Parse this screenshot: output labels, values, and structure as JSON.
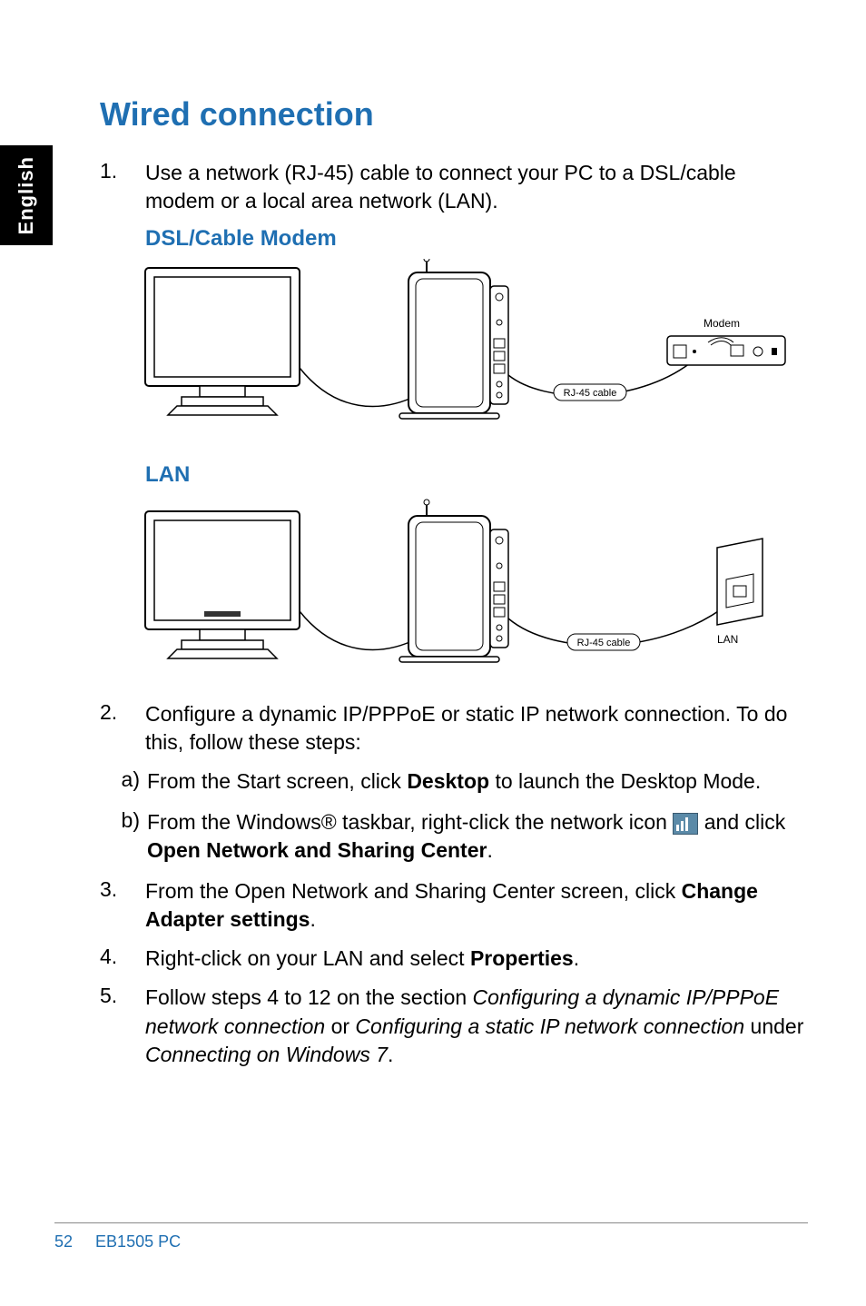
{
  "side_tab": "English",
  "heading": "Wired connection",
  "step1_num": "1.",
  "step1_body": "Use a network (RJ-45) cable to connect your PC to a DSL/cable modem or a local area network (LAN).",
  "dsl_heading": "DSL/Cable Modem",
  "dsl_modem_label": "Modem",
  "dsl_cable_label": "RJ-45 cable",
  "lan_heading": "LAN",
  "lan_cable_label": "RJ-45 cable",
  "lan_label": "LAN",
  "step2_num": "2.",
  "step2_body": "Configure a dynamic IP/PPPoE or static IP network connection. To do this, follow these steps:",
  "step2a_num": "a)",
  "step2a_pre": "From the Start screen, click ",
  "step2a_bold": "Desktop",
  "step2a_post": " to launch the Desktop Mode.",
  "step2b_num": "b)",
  "step2b_pre": "From the Windows® taskbar, right-click the network icon ",
  "step2b_post1": " and click ",
  "step2b_bold": "Open Network and Sharing Center",
  "step2b_post2": ".",
  "step3_num": "3.",
  "step3_pre": "From the Open Network and Sharing Center screen, click ",
  "step3_bold": "Change Adapter settings",
  "step3_post": ".",
  "step4_num": "4.",
  "step4_pre": "Right-click on your LAN and select ",
  "step4_bold": "Properties",
  "step4_post": ".",
  "step5_num": "5.",
  "step5_pre": "Follow steps 4 to 12 on the section ",
  "step5_it1": "Configuring a dynamic IP/PPPoE network connection",
  "step5_mid1": " or ",
  "step5_it2": "Configuring a static IP network connection",
  "step5_mid2": " under ",
  "step5_it3": "Connecting on Windows 7",
  "step5_post": ".",
  "footer_page": "52",
  "footer_model": "EB1505 PC"
}
